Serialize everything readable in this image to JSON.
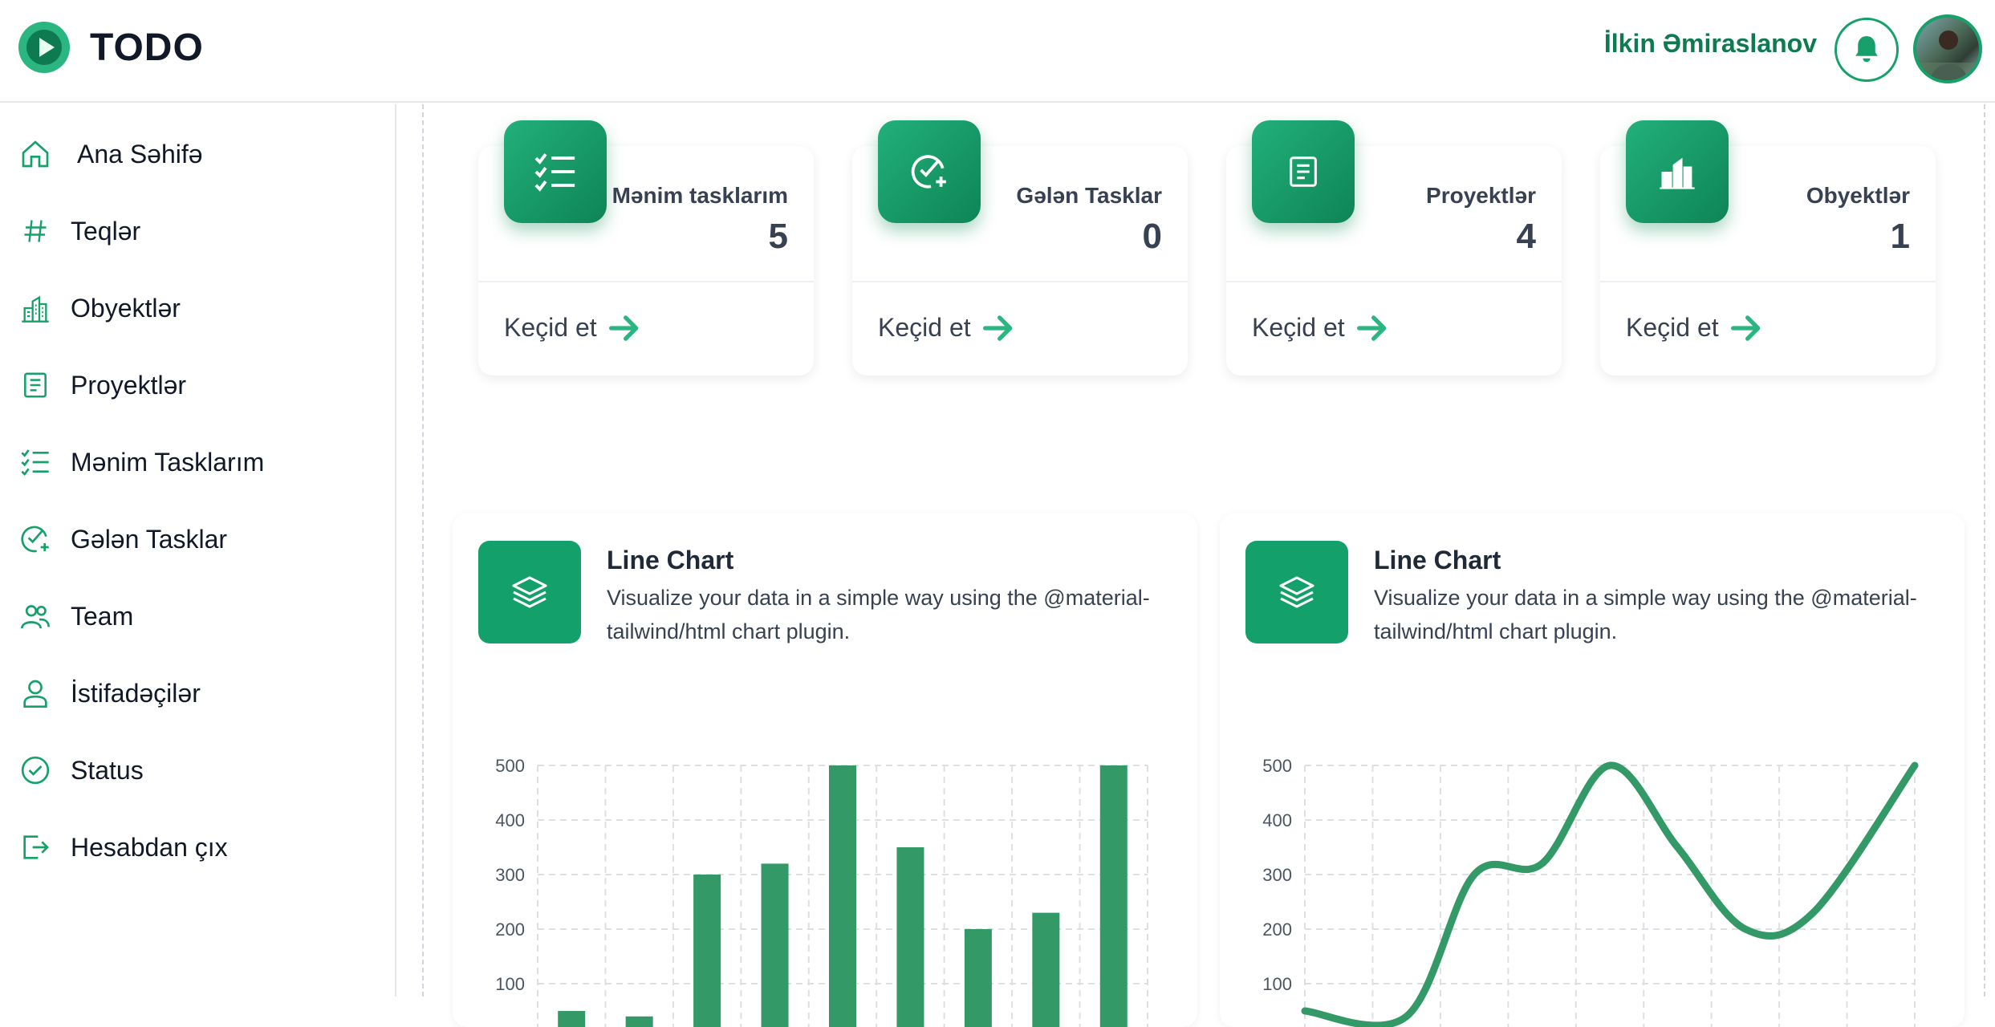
{
  "header": {
    "app_title": "TODO",
    "user_name": "İlkin Əmiraslanov",
    "logo_icon": "play-circle-logo",
    "bell_icon": "bell-icon",
    "accent": "#16a06a"
  },
  "sidebar": {
    "items": [
      {
        "label": "Ana Səhifə",
        "icon": "home-icon"
      },
      {
        "label": "Teqlər",
        "icon": "hashtag-icon"
      },
      {
        "label": "Obyektlər",
        "icon": "buildings-icon"
      },
      {
        "label": "Proyektlər",
        "icon": "document-icon"
      },
      {
        "label": "Mənim Tasklarım",
        "icon": "checklist-icon"
      },
      {
        "label": "Gələn Tasklar",
        "icon": "check-plus-icon"
      },
      {
        "label": "Team",
        "icon": "team-icon"
      },
      {
        "label": "İstifadəçilər",
        "icon": "user-icon"
      },
      {
        "label": "Status",
        "icon": "check-circle-icon"
      },
      {
        "label": "Hesabdan çıx",
        "icon": "logout-icon"
      }
    ]
  },
  "stats": [
    {
      "label": "Mənim tasklarım",
      "value": "5",
      "link": "Keçid et",
      "icon": "checklist-icon"
    },
    {
      "label": "Gələn Tasklar",
      "value": "0",
      "link": "Keçid et",
      "icon": "check-plus-icon"
    },
    {
      "label": "Proyektlər",
      "value": "4",
      "link": "Keçid et",
      "icon": "document-icon"
    },
    {
      "label": "Obyektlər",
      "value": "1",
      "link": "Keçid et",
      "icon": "buildings-icon"
    }
  ],
  "charts": [
    {
      "title": "Line Chart",
      "description": "Visualize your data in a simple way using the @material-tailwind/html chart plugin.",
      "icon": "layers-icon"
    },
    {
      "title": "Line Chart",
      "description": "Visualize your data in a simple way using the @material-tailwind/html chart plugin.",
      "icon": "layers-icon"
    }
  ],
  "chart_data": [
    {
      "type": "bar",
      "yticks": [
        "500",
        "400",
        "300",
        "200",
        "100"
      ],
      "values": [
        50,
        40,
        300,
        320,
        500,
        350,
        200,
        230,
        500
      ],
      "ylim": [
        0,
        500
      ],
      "color": "#339966",
      "grid": true
    },
    {
      "type": "line",
      "yticks": [
        "500",
        "400",
        "300",
        "200",
        "100"
      ],
      "values": [
        50,
        40,
        300,
        320,
        500,
        350,
        200,
        230,
        500
      ],
      "ylim": [
        0,
        500
      ],
      "color": "#339966",
      "grid": true
    }
  ]
}
